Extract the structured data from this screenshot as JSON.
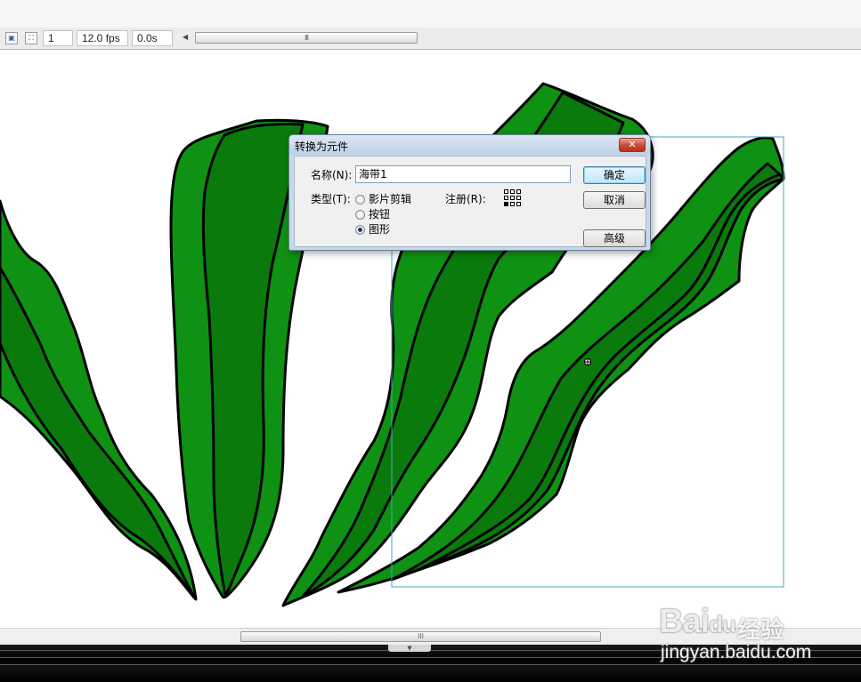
{
  "timeline": {
    "frame": "1",
    "fps": "12.0 fps",
    "time": "0.0s",
    "scroll_grip": "III"
  },
  "stage": {
    "leaf_colors": {
      "light": "#0f9113",
      "dark": "#0a7a0c",
      "outline": "#000000"
    },
    "selection_color": "#3fa9c4"
  },
  "dialog": {
    "title": "转换为元件",
    "close_label": "✕",
    "name_label": "名称(N):",
    "name_value": "海带1",
    "type_label": "类型(T):",
    "type_options": [
      "影片剪辑",
      "按钮",
      "图形"
    ],
    "selected_type": "图形",
    "registration_label": "注册(R):",
    "ok_label": "确定",
    "cancel_label": "取消",
    "advanced_label": "高级"
  },
  "bottom": {
    "scroll_grip": "III",
    "divider_grip": "▼"
  },
  "watermark": {
    "logo": "Bai",
    "logo_mark": "du",
    "cn": "经验",
    "url": "jingyan.baidu.com"
  }
}
